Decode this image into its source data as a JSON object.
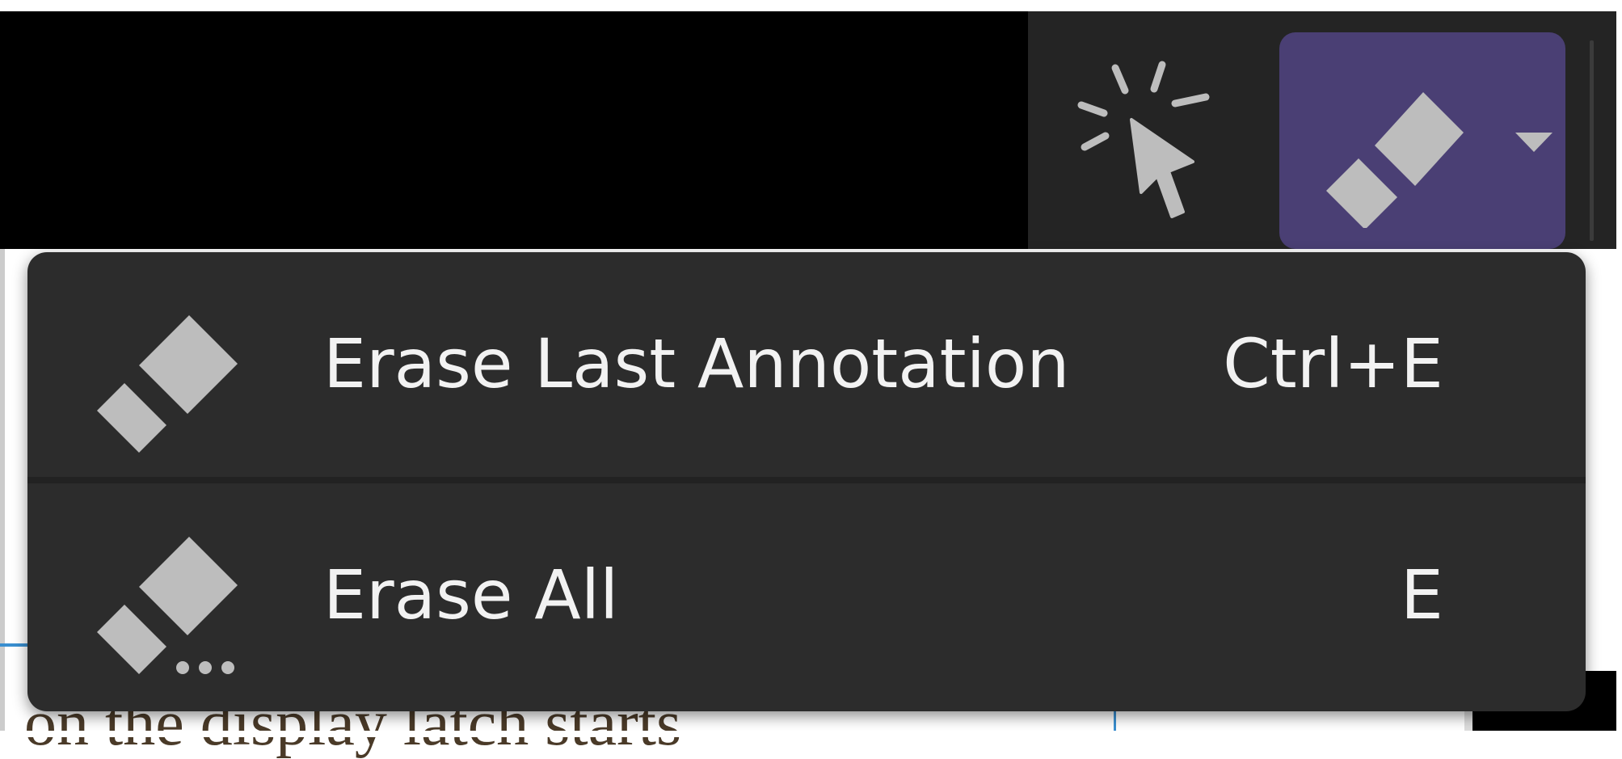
{
  "toolbar": {
    "laser_icon": "laser-pointer-icon",
    "eraser_icon": "eraser-icon",
    "dropdown_icon": "chevron-down-icon",
    "eraser_button_color": "#4a3f74"
  },
  "menu": {
    "items": [
      {
        "label": "Erase Last Annotation",
        "shortcut": "Ctrl+E",
        "icon": "eraser-icon"
      },
      {
        "label": "Erase All",
        "shortcut": "E",
        "icon": "eraser-all-icon"
      }
    ]
  },
  "page": {
    "partial_text": "on the display latch starts"
  },
  "colors": {
    "menu_bg": "#2c2c2c",
    "toolbar_bg": "#242424",
    "icon_gray": "#bdbdbd",
    "text": "#f2f2f2"
  }
}
